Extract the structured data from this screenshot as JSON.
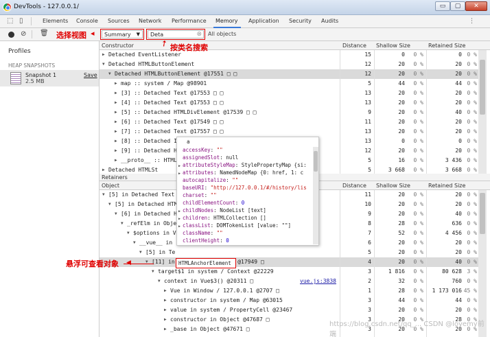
{
  "window": {
    "title": "DevTools - 127.0.0.1/",
    "controls": {
      "minimize": "▭",
      "maximize": "▢",
      "close": "✕"
    }
  },
  "tabs": [
    "Elements",
    "Console",
    "Sources",
    "Network",
    "Performance",
    "Memory",
    "Application",
    "Security",
    "Audits"
  ],
  "toolbar": {
    "summary": "Summary",
    "filter": "Deta",
    "objects": "All objects"
  },
  "sidebar": {
    "profiles": "Profiles",
    "heap_snapshots": "HEAP SNAPSHOTS",
    "snapshot_name": "Snapshot 1",
    "snapshot_size": "2.5 MB",
    "save": "Save"
  },
  "columns": {
    "constructor": "Constructor",
    "object": "Object",
    "retainers": "Retainers",
    "distance": "Distance",
    "shallow": "Shallow Size",
    "retained": "Retained Size"
  },
  "top_rows": [
    {
      "indent": 0,
      "arrow": "▶",
      "text": "Detached EventListener",
      "d": "15",
      "s": "0",
      "sp": "0 %",
      "r": "0",
      "rp": "0 %"
    },
    {
      "indent": 0,
      "arrow": "▼",
      "text": "Detached HTMLButtonElement",
      "d": "12",
      "s": "20",
      "sp": "0 %",
      "r": "20",
      "rp": "0 %"
    },
    {
      "indent": 1,
      "arrow": "▼",
      "text": "Detached HTMLButtonElement @17551 □ □",
      "d": "12",
      "s": "20",
      "sp": "0 %",
      "r": "20",
      "rp": "0 %",
      "hl": true
    },
    {
      "indent": 2,
      "arrow": "▶",
      "text": "map :: system / Map @98901",
      "d": "5",
      "s": "44",
      "sp": "0 %",
      "r": "44",
      "rp": "0 %"
    },
    {
      "indent": 2,
      "arrow": "▶",
      "text": "[3] :: Detached Text @17553 □ □",
      "d": "13",
      "s": "20",
      "sp": "0 %",
      "r": "20",
      "rp": "0 %"
    },
    {
      "indent": 2,
      "arrow": "▶",
      "text": "[4] :: Detached Text @17553 □ □",
      "d": "13",
      "s": "20",
      "sp": "0 %",
      "r": "20",
      "rp": "0 %"
    },
    {
      "indent": 2,
      "arrow": "▶",
      "text": "[5] :: Detached HTMLDivElement @17539 □ □",
      "d": "9",
      "s": "20",
      "sp": "0 %",
      "r": "40",
      "rp": "0 %"
    },
    {
      "indent": 2,
      "arrow": "▶",
      "text": "[6] :: Detached Text @17549 □ □",
      "d": "11",
      "s": "20",
      "sp": "0 %",
      "r": "20",
      "rp": "0 %"
    },
    {
      "indent": 2,
      "arrow": "▶",
      "text": "[7] :: Detached Text @17557 □ □",
      "d": "13",
      "s": "20",
      "sp": "0 %",
      "r": "20",
      "rp": "0 %"
    },
    {
      "indent": 2,
      "arrow": "▶",
      "text": "[8] :: Detached In",
      "d": "13",
      "s": "0",
      "sp": "0 %",
      "r": "0",
      "rp": "0 %"
    },
    {
      "indent": 2,
      "arrow": "▶",
      "text": "[9] :: Detached HT",
      "d": "12",
      "s": "20",
      "sp": "0 %",
      "r": "20",
      "rp": "0 %"
    },
    {
      "indent": 2,
      "arrow": "▶",
      "text": "__proto__ :: HTMLB",
      "d": "5",
      "s": "16",
      "sp": "0 %",
      "r": "3 436",
      "rp": "0 %"
    },
    {
      "indent": 0,
      "arrow": "▶",
      "text": "Detached HTMLSt",
      "d": "5",
      "s": "3 668",
      "sp": "0 %",
      "r": "3 668",
      "rp": "0 %"
    }
  ],
  "bottom_rows": [
    {
      "indent": 0,
      "arrow": "▼",
      "text": "[5] in Detached Text @",
      "d": "11",
      "s": "20",
      "sp": "0 %",
      "r": "20",
      "rp": "0 %"
    },
    {
      "indent": 1,
      "arrow": "▼",
      "text": "[5] in Detached HTML",
      "d": "10",
      "s": "20",
      "sp": "0 %",
      "r": "20",
      "rp": "0 %"
    },
    {
      "indent": 2,
      "arrow": "▼",
      "text": "[6] in Detached HT",
      "d": "9",
      "s": "20",
      "sp": "0 %",
      "r": "40",
      "rp": "0 %"
    },
    {
      "indent": 3,
      "arrow": "▼",
      "text": "_refElm in Object",
      "d": "8",
      "s": "28",
      "sp": "0 %",
      "r": "636",
      "rp": "0 %"
    },
    {
      "indent": 4,
      "arrow": "▼",
      "text": "$options in Vu",
      "d": "7",
      "s": "52",
      "sp": "0 %",
      "r": "4 456",
      "rp": "0 %"
    },
    {
      "indent": 5,
      "arrow": "▼",
      "text": "__vue__ in",
      "d": "6",
      "s": "20",
      "sp": "0 %",
      "r": "20",
      "rp": "0 %"
    },
    {
      "indent": 6,
      "arrow": "▼",
      "text": "[5] in Te",
      "d": "5",
      "s": "20",
      "sp": "0 %",
      "r": "20",
      "rp": "0 %"
    },
    {
      "indent": 7,
      "arrow": "▼",
      "text": "[11] in HTMLAnchorElement @17949 □",
      "d": "4",
      "s": "20",
      "sp": "0 %",
      "r": "40",
      "rp": "0 %",
      "hl": true
    },
    {
      "indent": 8,
      "arrow": "▼",
      "text": "target$1 in system / Context @22229",
      "d": "3",
      "s": "1 816",
      "sp": "0 %",
      "r": "80 628",
      "rp": "3 %"
    },
    {
      "indent": 9,
      "arrow": "▼",
      "text": "context in Vue$3() @20311 □",
      "d": "2",
      "s": "32",
      "sp": "0 %",
      "r": "760",
      "rp": "0 %",
      "link": "vue.js:3838"
    },
    {
      "indent": 10,
      "arrow": "▶",
      "text": "Vue in Window / 127.0.0.1 @2707 □",
      "d": "1",
      "s": "28",
      "sp": "0 %",
      "r": "1 173 016",
      "rp": "45 %"
    },
    {
      "indent": 10,
      "arrow": "▶",
      "text": "constructor in system / Map @63015",
      "d": "3",
      "s": "44",
      "sp": "0 %",
      "r": "44",
      "rp": "0 %"
    },
    {
      "indent": 10,
      "arrow": "▶",
      "text": "value in system / PropertyCell @23467",
      "d": "3",
      "s": "20",
      "sp": "0 %",
      "r": "20",
      "rp": "0 %"
    },
    {
      "indent": 10,
      "arrow": "▶",
      "text": "constructor in Object @47687 □",
      "d": "3",
      "s": "20",
      "sp": "0 %",
      "r": "28",
      "rp": "0 %"
    },
    {
      "indent": 10,
      "arrow": "▶",
      "text": "_base in Object @47671 □",
      "d": "3",
      "s": "20",
      "sp": "0 %",
      "r": "20",
      "rp": "0 %"
    }
  ],
  "popup": {
    "title": "a",
    "lines": [
      {
        "a": "",
        "k": "accessKey",
        "v": "\"\"",
        "t": "str"
      },
      {
        "a": "",
        "k": "assignedSlot",
        "v": "null",
        "t": "plain"
      },
      {
        "a": "▶",
        "k": "attributeStyleMap",
        "v": "StylePropertyMap {si:",
        "t": "plain"
      },
      {
        "a": "▶",
        "k": "attributes",
        "v": "NamedNodeMap {0: href, 1: c",
        "t": "plain"
      },
      {
        "a": "",
        "k": "autocapitalize",
        "v": "\"\"",
        "t": "str"
      },
      {
        "a": "",
        "k": "baseURI",
        "v": "\"http://127.0.0.1/#/history/lis",
        "t": "str"
      },
      {
        "a": "",
        "k": "charset",
        "v": "\"\"",
        "t": "str"
      },
      {
        "a": "",
        "k": "childElementCount",
        "v": "0",
        "t": "num"
      },
      {
        "a": "▶",
        "k": "childNodes",
        "v": "NodeList [text]",
        "t": "plain"
      },
      {
        "a": "▶",
        "k": "children",
        "v": "HTMLCollection []",
        "t": "plain"
      },
      {
        "a": "▶",
        "k": "classList",
        "v": "DOMTokenList [value: \"\"]",
        "t": "plain"
      },
      {
        "a": "",
        "k": "className",
        "v": "\"\"",
        "t": "str"
      },
      {
        "a": "",
        "k": "clientHeight",
        "v": "0",
        "t": "num"
      }
    ]
  },
  "annotations": {
    "select_view": "选择视图",
    "search_by_class": "按类名搜索",
    "hover_view": "悬浮可查看对象"
  },
  "highlight_box_text": "HTMLAnchorElement",
  "watermark": "https://blog.csdn.net/qq_... CSDN @lovemy前端",
  "colors": {
    "accent": "#3879d9",
    "annotation": "#e00000",
    "highlight_row": "#dadada"
  }
}
